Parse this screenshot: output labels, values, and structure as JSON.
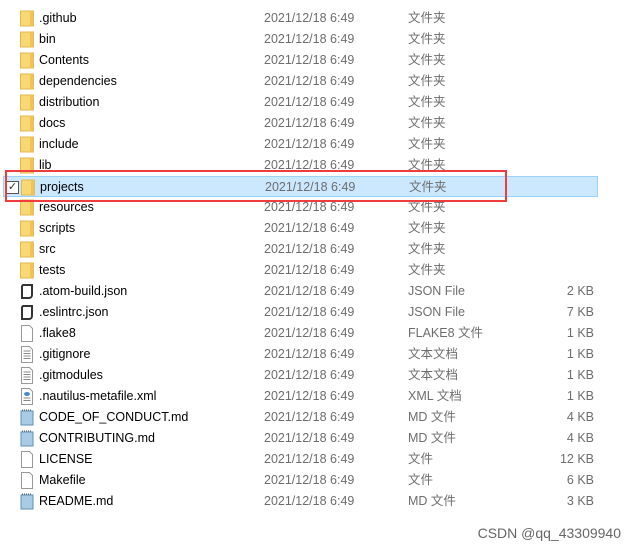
{
  "files": [
    {
      "name": ".github",
      "date": "2021/12/18 6:49",
      "type": "文件夹",
      "size": "",
      "icon": "folder-icon"
    },
    {
      "name": "bin",
      "date": "2021/12/18 6:49",
      "type": "文件夹",
      "size": "",
      "icon": "folder-icon"
    },
    {
      "name": "Contents",
      "date": "2021/12/18 6:49",
      "type": "文件夹",
      "size": "",
      "icon": "folder-icon"
    },
    {
      "name": "dependencies",
      "date": "2021/12/18 6:49",
      "type": "文件夹",
      "size": "",
      "icon": "folder-icon"
    },
    {
      "name": "distribution",
      "date": "2021/12/18 6:49",
      "type": "文件夹",
      "size": "",
      "icon": "folder-icon"
    },
    {
      "name": "docs",
      "date": "2021/12/18 6:49",
      "type": "文件夹",
      "size": "",
      "icon": "folder-icon"
    },
    {
      "name": "include",
      "date": "2021/12/18 6:49",
      "type": "文件夹",
      "size": "",
      "icon": "folder-icon"
    },
    {
      "name": "lib",
      "date": "2021/12/18 6:49",
      "type": "文件夹",
      "size": "",
      "icon": "folder-icon"
    },
    {
      "name": "projects",
      "date": "2021/12/18 6:49",
      "type": "文件夹",
      "size": "",
      "icon": "folder-icon",
      "selected": true
    },
    {
      "name": "resources",
      "date": "2021/12/18 6:49",
      "type": "文件夹",
      "size": "",
      "icon": "folder-icon"
    },
    {
      "name": "scripts",
      "date": "2021/12/18 6:49",
      "type": "文件夹",
      "size": "",
      "icon": "folder-icon"
    },
    {
      "name": "src",
      "date": "2021/12/18 6:49",
      "type": "文件夹",
      "size": "",
      "icon": "folder-icon"
    },
    {
      "name": "tests",
      "date": "2021/12/18 6:49",
      "type": "文件夹",
      "size": "",
      "icon": "folder-icon"
    },
    {
      "name": ".atom-build.json",
      "date": "2021/12/18 6:49",
      "type": "JSON File",
      "size": "2 KB",
      "icon": "json-file-icon"
    },
    {
      "name": ".eslintrc.json",
      "date": "2021/12/18 6:49",
      "type": "JSON File",
      "size": "7 KB",
      "icon": "json-file-icon"
    },
    {
      "name": ".flake8",
      "date": "2021/12/18 6:49",
      "type": "FLAKE8 文件",
      "size": "1 KB",
      "icon": "blank-file-icon"
    },
    {
      "name": ".gitignore",
      "date": "2021/12/18 6:49",
      "type": "文本文档",
      "size": "1 KB",
      "icon": "text-file-icon"
    },
    {
      "name": ".gitmodules",
      "date": "2021/12/18 6:49",
      "type": "文本文档",
      "size": "1 KB",
      "icon": "text-file-icon"
    },
    {
      "name": ".nautilus-metafile.xml",
      "date": "2021/12/18 6:49",
      "type": "XML 文档",
      "size": "1 KB",
      "icon": "xml-file-icon"
    },
    {
      "name": "CODE_OF_CONDUCT.md",
      "date": "2021/12/18 6:49",
      "type": "MD 文件",
      "size": "4 KB",
      "icon": "md-file-icon"
    },
    {
      "name": "CONTRIBUTING.md",
      "date": "2021/12/18 6:49",
      "type": "MD 文件",
      "size": "4 KB",
      "icon": "md-file-icon"
    },
    {
      "name": "LICENSE",
      "date": "2021/12/18 6:49",
      "type": "文件",
      "size": "12 KB",
      "icon": "blank-file-icon"
    },
    {
      "name": "Makefile",
      "date": "2021/12/18 6:49",
      "type": "文件",
      "size": "6 KB",
      "icon": "blank-file-icon"
    },
    {
      "name": "README.md",
      "date": "2021/12/18 6:49",
      "type": "MD 文件",
      "size": "3 KB",
      "icon": "md-file-icon"
    }
  ],
  "checkbox_mark": "✓",
  "watermark": "CSDN @qq_43309940",
  "colors": {
    "selection": "#cce8ff",
    "highlight_box": "#f03c3c",
    "folder": "#f8d775"
  }
}
